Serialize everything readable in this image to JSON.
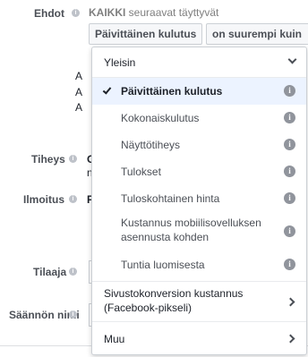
{
  "form": {
    "conditions_label": "Ehdot",
    "conditions_text_bold": "KAIKKI",
    "conditions_text_rest": " seuraavat täyttyvät",
    "metric_button": "Päivittäinen kulutus",
    "operator_button": "on suurempi kuin",
    "frequency_label": "Tiheys",
    "notify_label": "Ilmoitus",
    "subscriber_label": "Tilaaja",
    "rule_name_label": "Säännön nimi",
    "hidden_fragments": [
      "A",
      "A",
      "A",
      "O",
      "n",
      "F"
    ]
  },
  "dropdown": {
    "category_label": "Yleisin",
    "items": [
      {
        "label": "Päivittäinen kulutus",
        "selected": true
      },
      {
        "label": "Kokonaiskulutus",
        "selected": false
      },
      {
        "label": "Näyttötiheys",
        "selected": false
      },
      {
        "label": "Tulokset",
        "selected": false
      },
      {
        "label": "Tuloskohtainen hinta",
        "selected": false
      },
      {
        "label": "Kustannus mobiilisovelluksen asennusta kohden",
        "selected": false
      },
      {
        "label": "Tuntia luomisesta",
        "selected": false
      }
    ],
    "submenus": [
      {
        "label": "Sivustokonversion kustannus (Facebook-pikseli)"
      },
      {
        "label": "Muu"
      }
    ]
  },
  "icons": {
    "info": "info-icon",
    "check": "check-icon",
    "chevron_down": "chevron-down-icon",
    "chevron_right": "chevron-right-icon"
  },
  "colors": {
    "selected_bg": "#ecf3ff",
    "info_icon": "#90949c"
  }
}
